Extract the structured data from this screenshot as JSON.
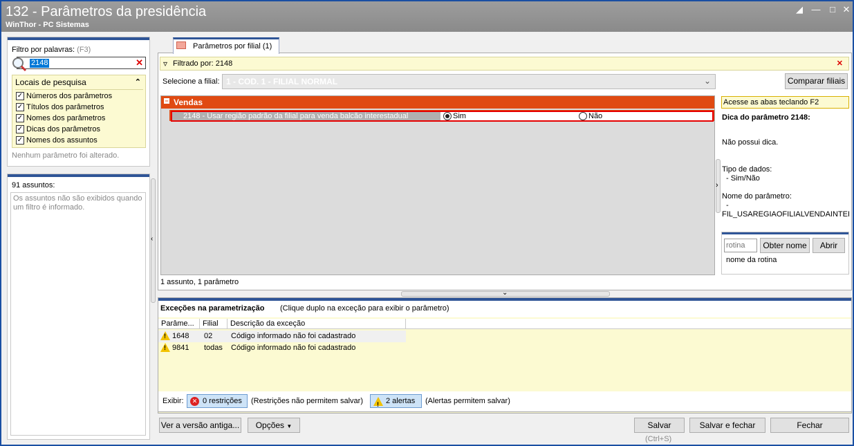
{
  "window": {
    "title": "132 - Parâmetros da presidência",
    "subtitle": "WinThor - PC Sistemas"
  },
  "left": {
    "filter_label": "Filtro por palavras:",
    "filter_shortcut": "(F3)",
    "filter_value": "2148",
    "locais_title": "Locais de pesquisa",
    "locais": [
      {
        "label": "Números dos parâmetros",
        "checked": true
      },
      {
        "label": "Títulos dos parâmetros",
        "checked": true
      },
      {
        "label": "Nomes dos parâmetros",
        "checked": true
      },
      {
        "label": "Dicas dos parâmetros",
        "checked": true
      },
      {
        "label": "Nomes dos assuntos",
        "checked": true
      }
    ],
    "status": "Nenhum parâmetro foi alterado.",
    "assuntos_count": "91 assuntos:",
    "assuntos_note": "Os assuntos não são exibidos quando um filtro é informado."
  },
  "tab": {
    "label": "Parâmetros por filial",
    "count": "(1)"
  },
  "filter_bar": {
    "text": "Filtrado por: 2148"
  },
  "filial": {
    "label": "Selecione a filial:",
    "value": "1 - COD. 1 - FILIAL NORMAL",
    "compare_button": "Comparar filiais"
  },
  "grid": {
    "group": "Vendas",
    "param": "2148 - Usar região padrão da filial para venda balcão interestadual",
    "option_yes": "Sim",
    "option_no": "Não",
    "selected": "Sim",
    "footer": "1 assunto, 1 parâmetro"
  },
  "hint": {
    "access": "Acesse as abas teclando F2",
    "title": "Dica do parâmetro 2148:",
    "text": "Não possui dica.",
    "tipo_label": "Tipo de dados:",
    "tipo_value": "- Sim/Não",
    "nome_label": "Nome do parâmetro:",
    "nome_dash": "-",
    "nome_value": "FIL_USAREGIAOFILIALVENDAINTERES"
  },
  "rotina": {
    "placeholder": "rotina",
    "obter_button": "Obter nome",
    "abrir_button": "Abrir",
    "caption": "nome da rotina"
  },
  "excecoes": {
    "title": "Exceções na parametrização",
    "subtitle": "(Clique duplo na exceção para exibir o parâmetro)",
    "columns": [
      "Parâme...",
      "Filial",
      "Descrição da exceção"
    ],
    "rows": [
      {
        "param": "1648",
        "filial": "02",
        "desc": "Código informado não foi cadastrado"
      },
      {
        "param": "9841",
        "filial": "todas",
        "desc": "Código informado não foi cadastrado"
      }
    ],
    "exibir_label": "Exibir:",
    "restricoes_chip": "0 restrições",
    "restricoes_note": "(Restrições não permitem salvar)",
    "alertas_chip": "2 alertas",
    "alertas_note": "(Alertas permitem salvar)"
  },
  "bottom": {
    "versao_button": "Ver a versão antiga...",
    "opcoes_button": "Opções",
    "salvar_button": "Salvar",
    "salvar_shortcut": "(Ctrl+S)",
    "salvar_fechar_button": "Salvar e fechar",
    "fechar_button": "Fechar"
  },
  "colors": {
    "accent_blue": "#2f5597",
    "group_orange": "#e04a12",
    "highlight_red": "#e60000",
    "note_yellow": "#fcfad2"
  }
}
